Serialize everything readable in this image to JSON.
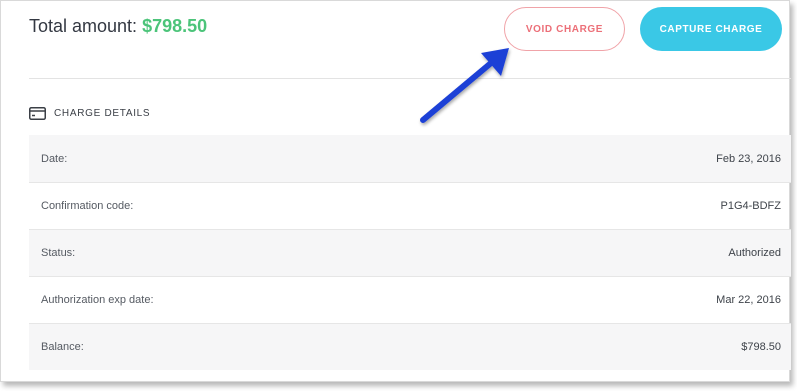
{
  "header": {
    "total_label": "Total amount:",
    "total_amount": "$798.50",
    "void_button_label": "VOID CHARGE",
    "capture_button_label": "CAPTURE CHARGE"
  },
  "section": {
    "title": "CHARGE DETAILS",
    "icon": "credit-card-icon"
  },
  "details": [
    {
      "label": "Date:",
      "value": "Feb 23, 2016"
    },
    {
      "label": "Confirmation code:",
      "value": "P1G4-BDFZ"
    },
    {
      "label": "Status:",
      "value": "Authorized"
    },
    {
      "label": "Authorization exp date:",
      "value": "Mar 22, 2016"
    },
    {
      "label": "Balance:",
      "value": "$798.50"
    }
  ],
  "annotation": {
    "icon": "arrow-annotation-icon",
    "color": "#1b3fd6"
  },
  "colors": {
    "amount": "#4cc47a",
    "void": "#ec6f78",
    "capture": "#3ac8e6"
  }
}
